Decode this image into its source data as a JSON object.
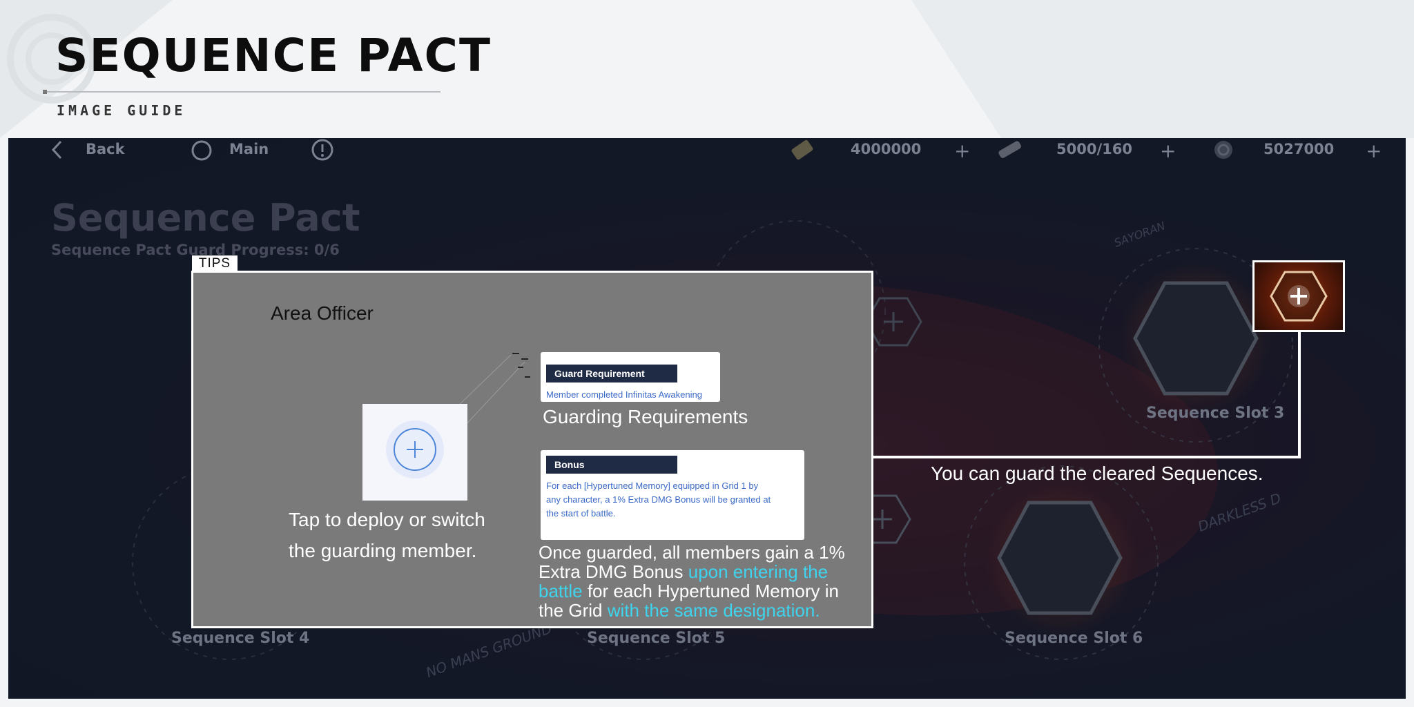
{
  "header": {
    "title": "SEQUENCE PACT",
    "subtitle": "IMAGE GUIDE"
  },
  "topbar": {
    "back_label": "Back",
    "main_label": "Main",
    "currency_1": "4000000",
    "currency_2": "5000/160",
    "currency_3": "5027000",
    "plus": "+",
    "icons": [
      "chevron-left-icon",
      "circle-icon",
      "info-icon",
      "ticket-icon",
      "key-icon",
      "coin-icon",
      "plus-icon"
    ]
  },
  "background": {
    "title": "Sequence Pact",
    "progress": "Sequence Pact Guard Progress: 0/6",
    "slots": [
      "Sequence Slot 3",
      "Sequence Slot 4",
      "Sequence Slot 5",
      "Sequence Slot 6"
    ],
    "region_texts": [
      "NO MANS GROUND",
      "DARKLESS D",
      "SAYORAN"
    ]
  },
  "tips": {
    "label": "TIPS",
    "area_officer": "Area Officer",
    "deploy_caption": "Tap to deploy or switch the guarding member.",
    "guard_requirement": {
      "header": "Guard Requirement",
      "body": "Member completed Infinitas Awakening",
      "caption": "Guarding Requirements"
    },
    "bonus": {
      "header": "Bonus",
      "body": "For each [Hypertuned Memory] equipped in Grid 1 by any character, a 1% Extra DMG Bonus will be granted at the start of battle.",
      "caption_parts": [
        "Once guarded, all members gain a 1% Extra DMG Bonus ",
        "upon entering the battle",
        " for each Hypertuned Memory in the Grid ",
        "with the same designation."
      ]
    }
  },
  "callout": {
    "caption": "You can guard the cleared Sequences."
  },
  "colors": {
    "highlight": "#3fd3ee",
    "card_header": "#1f2a44",
    "card_text": "#3b69c8",
    "tips_bg": "#7a7a7a"
  }
}
